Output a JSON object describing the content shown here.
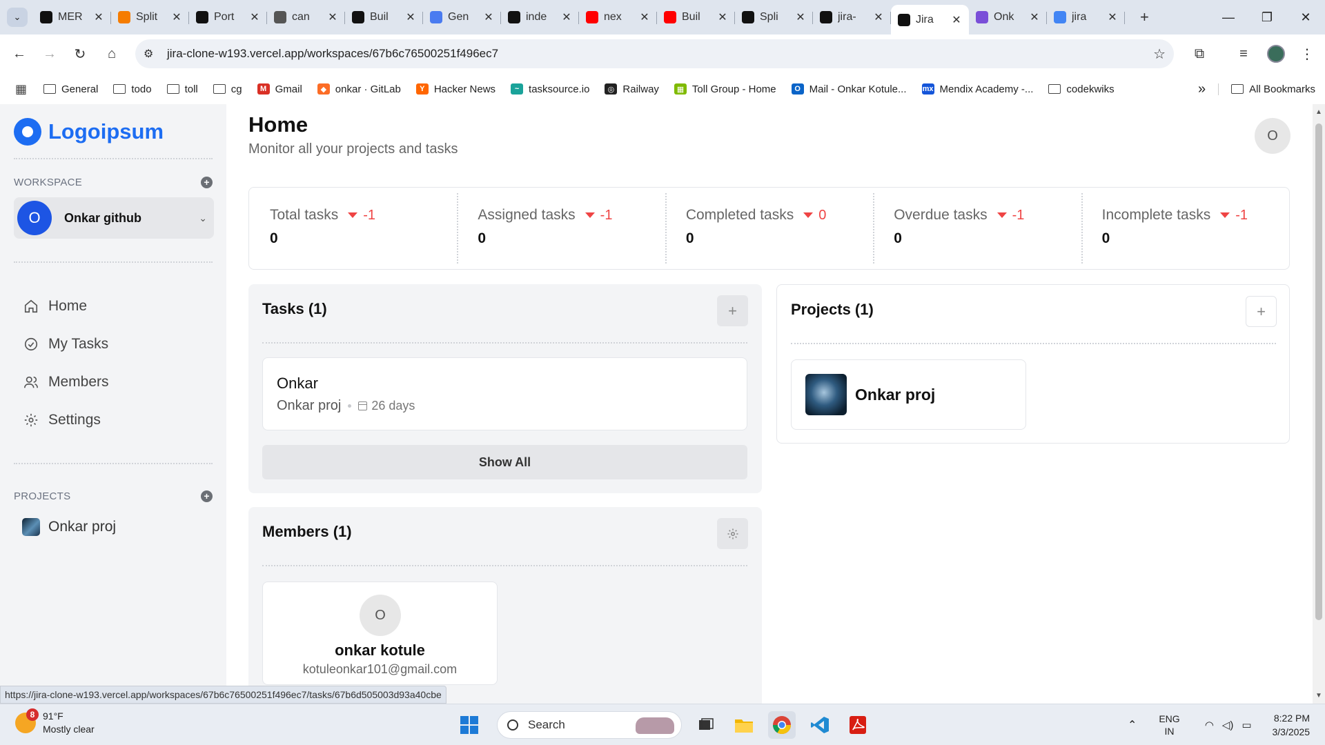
{
  "browser": {
    "tabs": [
      {
        "title": "MER",
        "favicon": "openai-icon",
        "color": "#111111"
      },
      {
        "title": "Split",
        "favicon": "fire-icon",
        "color": "#f57c00"
      },
      {
        "title": "Port",
        "favicon": "github-icon",
        "color": "#111111"
      },
      {
        "title": "can",
        "favicon": "globe-icon",
        "color": "#555555"
      },
      {
        "title": "Buil",
        "favicon": "vercel-a-icon",
        "color": "#111111"
      },
      {
        "title": "Gen",
        "favicon": "gemini-icon",
        "color": "#4a7bf0"
      },
      {
        "title": "inde",
        "favicon": "notion-icon",
        "color": "#111111"
      },
      {
        "title": "nex",
        "favicon": "youtube-icon",
        "color": "#ff0000"
      },
      {
        "title": "Buil",
        "favicon": "youtube-icon",
        "color": "#ff0000"
      },
      {
        "title": "Spli",
        "favicon": "link-icon",
        "color": "#111111"
      },
      {
        "title": "jira-",
        "favicon": "vercel-icon",
        "color": "#111111"
      },
      {
        "title": "Jira",
        "favicon": "vercel-icon",
        "color": "#111111",
        "active": true
      },
      {
        "title": "Onk",
        "favicon": "ok-icon",
        "color": "#7a4fd8"
      },
      {
        "title": "jira",
        "favicon": "google-icon",
        "color": "#4285f4"
      }
    ],
    "url": "jira-clone-w193.vercel.app/workspaces/67b6c76500251f496ec7",
    "bookmarks": [
      {
        "label": "General",
        "type": "folder"
      },
      {
        "label": "todo",
        "type": "folder"
      },
      {
        "label": "toll",
        "type": "folder"
      },
      {
        "label": "cg",
        "type": "folder"
      },
      {
        "label": "Gmail",
        "type": "site",
        "icon": "gmail-icon",
        "color": "#d93025",
        "glyph": "M"
      },
      {
        "label": "onkar · GitLab",
        "type": "site",
        "icon": "gitlab-icon",
        "color": "#fc6d26",
        "glyph": "◆"
      },
      {
        "label": "Hacker News",
        "type": "site",
        "icon": "hackernews-icon",
        "color": "#ff6600",
        "glyph": "Y"
      },
      {
        "label": "tasksource.io",
        "type": "site",
        "icon": "tasksource-icon",
        "color": "#1aa39a",
        "glyph": "~"
      },
      {
        "label": "Railway",
        "type": "site",
        "icon": "railway-icon",
        "color": "#222222",
        "glyph": "◎"
      },
      {
        "label": "Toll Group - Home",
        "type": "site",
        "icon": "microsoft-icon",
        "color": "#7fba00",
        "glyph": "▦"
      },
      {
        "label": "Mail - Onkar Kotule...",
        "type": "site",
        "icon": "outlook-icon",
        "color": "#0a64c8",
        "glyph": "O"
      },
      {
        "label": "Mendix Academy -...",
        "type": "site",
        "icon": "mendix-icon",
        "color": "#1455d9",
        "glyph": "mx"
      },
      {
        "label": "codekwiks",
        "type": "folder"
      }
    ],
    "all_bookmarks": "All Bookmarks",
    "status_url": "https://jira-clone-w193.vercel.app/workspaces/67b6c76500251f496ec7/tasks/67b6d505003d93a40cbe"
  },
  "sidebar": {
    "logo": "Logoipsum",
    "workspace_label": "WORKSPACE",
    "workspace": {
      "initial": "O",
      "name": "Onkar github"
    },
    "nav": [
      {
        "label": "Home",
        "icon": "home-icon"
      },
      {
        "label": "My Tasks",
        "icon": "check-circle-icon"
      },
      {
        "label": "Members",
        "icon": "users-icon"
      },
      {
        "label": "Settings",
        "icon": "gear-icon"
      }
    ],
    "projects_label": "PROJECTS",
    "projects": [
      {
        "name": "Onkar proj"
      }
    ]
  },
  "header": {
    "title": "Home",
    "subtitle": "Monitor all your projects and tasks",
    "user_initial": "O"
  },
  "stats": [
    {
      "label": "Total tasks",
      "delta": "-1",
      "value": "0"
    },
    {
      "label": "Assigned tasks",
      "delta": "-1",
      "value": "0"
    },
    {
      "label": "Completed tasks",
      "delta": "0",
      "value": "0"
    },
    {
      "label": "Overdue tasks",
      "delta": "-1",
      "value": "0"
    },
    {
      "label": "Incomplete tasks",
      "delta": "-1",
      "value": "0"
    }
  ],
  "tasks": {
    "title": "Tasks (1)",
    "items": [
      {
        "name": "Onkar",
        "project": "Onkar proj",
        "due": "26 days"
      }
    ],
    "show_all": "Show All"
  },
  "projects": {
    "title": "Projects (1)",
    "items": [
      {
        "name": "Onkar proj"
      }
    ]
  },
  "members": {
    "title": "Members (1)",
    "items": [
      {
        "initial": "O",
        "name": "onkar kotule",
        "email": "kotuleonkar101@gmail.com"
      }
    ]
  },
  "taskbar": {
    "weather_temp": "91°F",
    "weather_desc": "Mostly clear",
    "weather_badge": "8",
    "search": "Search",
    "lang_line1": "ENG",
    "lang_line2": "IN",
    "time": "8:22 PM",
    "date": "3/3/2025"
  }
}
